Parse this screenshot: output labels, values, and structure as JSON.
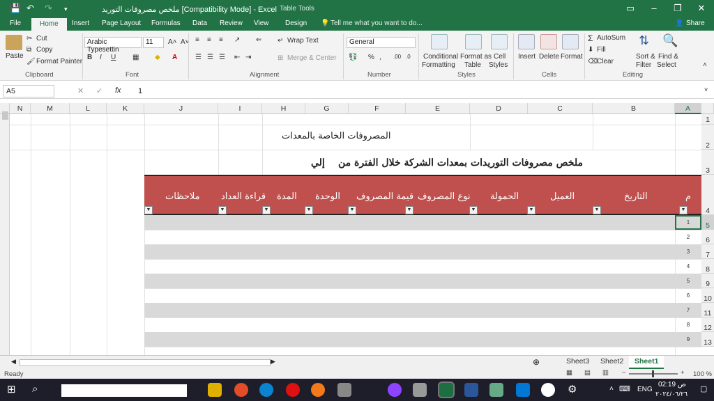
{
  "window": {
    "title": "ملخص مصروفات التوريد  [Compatibility Mode] - Excel",
    "context_tab_group": "Table Tools"
  },
  "tabs": [
    "File",
    "Home",
    "Insert",
    "Page Layout",
    "Formulas",
    "Data",
    "Review",
    "View",
    "Design"
  ],
  "tell_me": "Tell me what you want to do...",
  "share": "Share",
  "ribbon": {
    "clipboard": {
      "paste": "Paste",
      "cut": "Cut",
      "copy": "Copy",
      "format_painter": "Format Painter",
      "group": "Clipboard"
    },
    "font": {
      "name": "Arabic Typesettin",
      "size": "11",
      "group": "Font"
    },
    "alignment": {
      "wrap_text": "Wrap Text",
      "merge_center": "Merge & Center",
      "group": "Alignment"
    },
    "number": {
      "format": "General",
      "group": "Number"
    },
    "styles": {
      "conditional": "Conditional",
      "formatting": "Formatting",
      "format_as": "Format as",
      "table": "Table",
      "cell": "Cell",
      "cell_styles": "Styles",
      "group": "Styles"
    },
    "cells": {
      "insert": "Insert",
      "delete": "Delete",
      "format": "Format",
      "group": "Cells"
    },
    "editing": {
      "autosum": "AutoSum",
      "fill": "Fill",
      "clear": "Clear",
      "sort": "Sort &",
      "filter": "Filter",
      "find": "Find &",
      "select": "Select",
      "group": "Editing"
    }
  },
  "formula_bar": {
    "name_box": "A5",
    "fx": "fx",
    "value": "1"
  },
  "columns": [
    "N",
    "M",
    "L",
    "K",
    "J",
    "I",
    "H",
    "G",
    "F",
    "E",
    "D",
    "C",
    "B",
    "A"
  ],
  "rows": [
    "1",
    "2",
    "3",
    "4",
    "5",
    "6",
    "7",
    "8",
    "9",
    "10",
    "11",
    "12",
    "13"
  ],
  "sheet": {
    "heading1": "المصروفات الخاصة بالمعدات",
    "heading2": "ملخص مصروفات التوريدات بمعدات الشركة خلال الفترة من",
    "heading2_to": "إلي",
    "table_headers": [
      "م",
      "التاريخ",
      "العميل",
      "الحمولة",
      "نوع المصروف",
      "قيمة المصروف",
      "الوحدة",
      "المدة",
      "قراءة العداد",
      "ملاحظات"
    ],
    "row_numbers": [
      "1",
      "2",
      "3",
      "4",
      "5",
      "6",
      "7",
      "8",
      "9"
    ]
  },
  "sheet_tabs": [
    "Sheet3",
    "Sheet2",
    "Sheet1"
  ],
  "status": {
    "ready": "Ready",
    "zoom": "100 %"
  },
  "taskbar": {
    "time": "02:19 ص",
    "date": "٢٠٢٤/٠٦/٢٦",
    "lang": "ENG"
  }
}
